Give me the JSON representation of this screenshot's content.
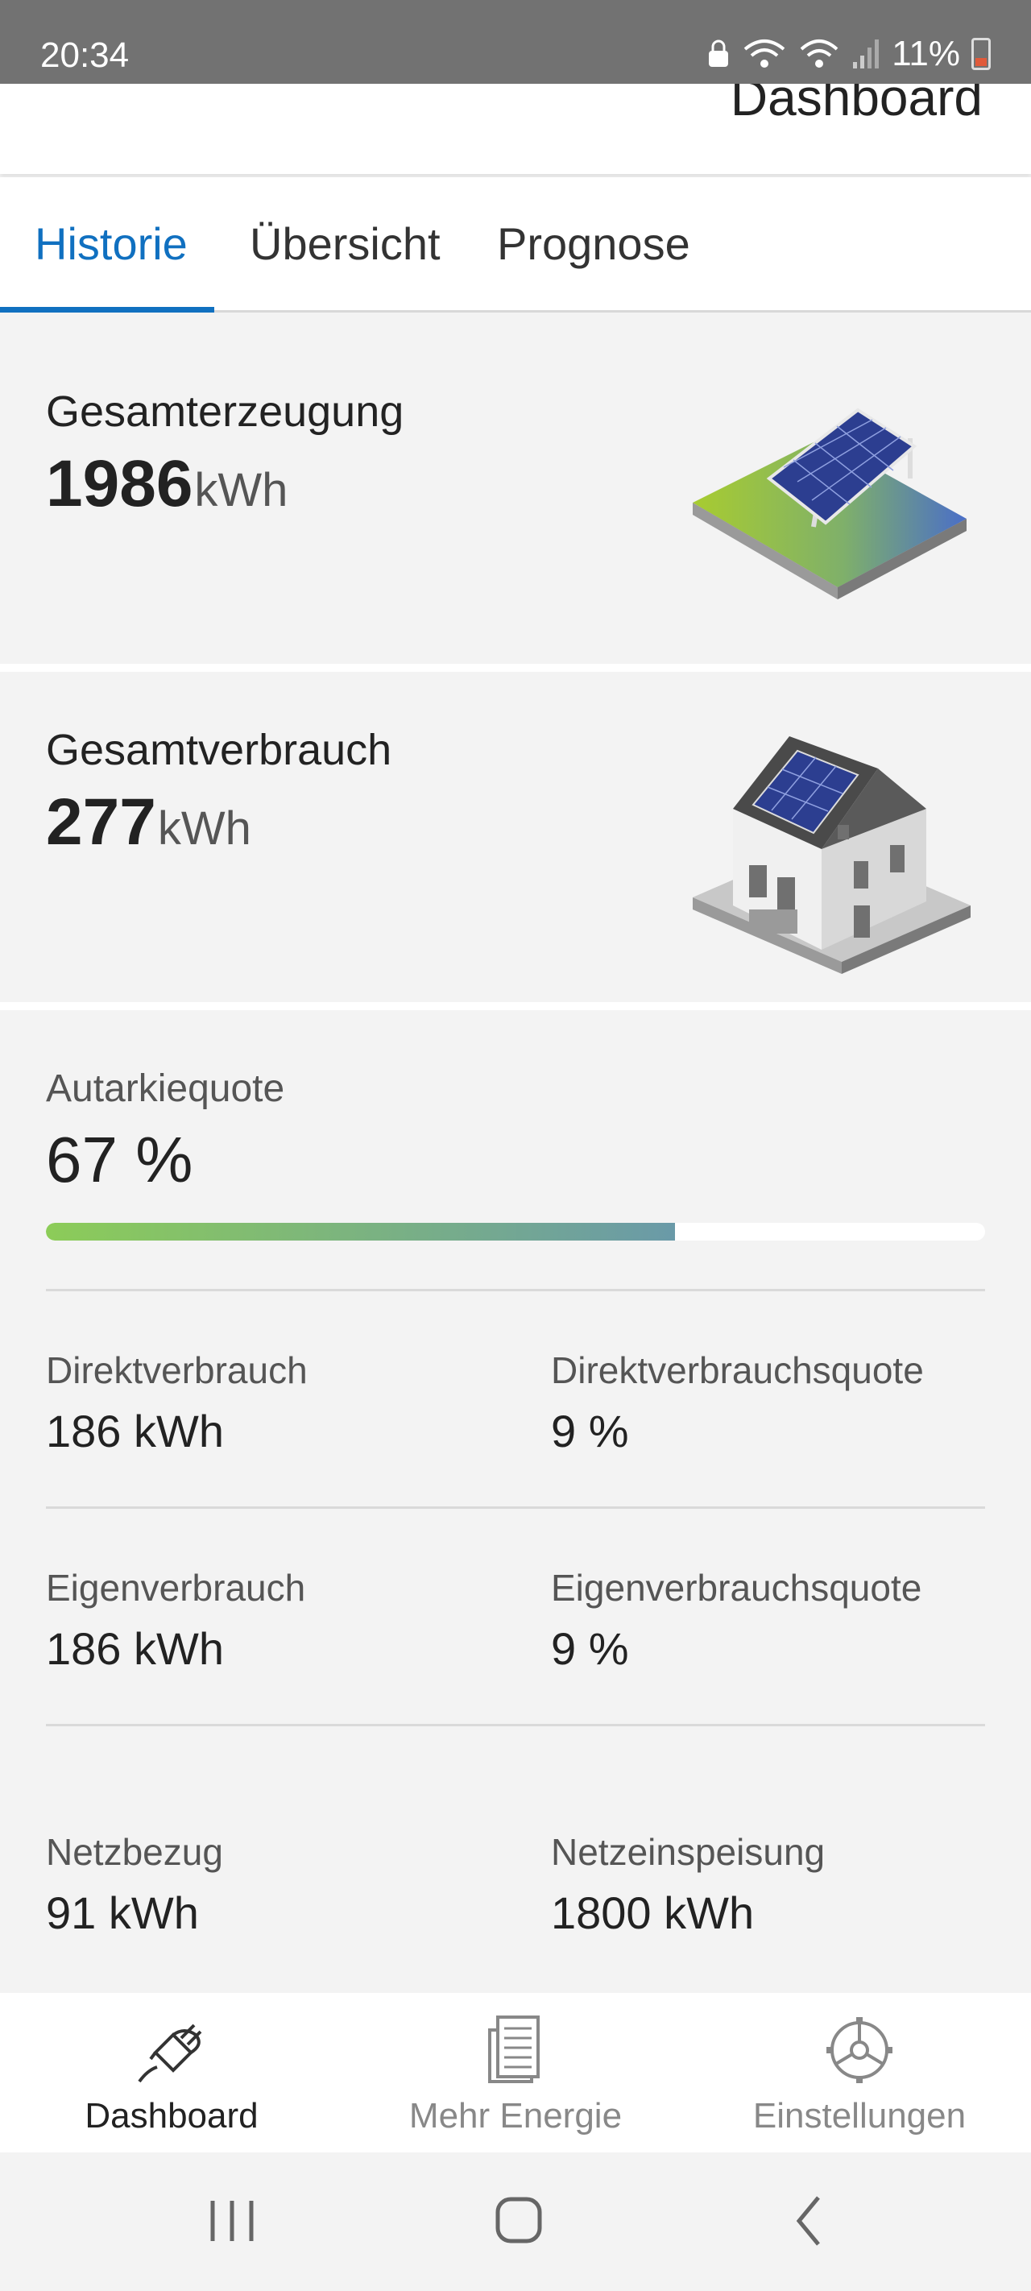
{
  "status_bar": {
    "time": "20:34",
    "battery": "11%"
  },
  "header": {
    "title": "Dashboard"
  },
  "tabs": [
    {
      "label": "Historie",
      "active": true
    },
    {
      "label": "Übersicht",
      "active": false
    },
    {
      "label": "Prognose",
      "active": false
    }
  ],
  "generation": {
    "label": "Gesamterzeugung",
    "value": "1986",
    "unit": "kWh"
  },
  "consumption": {
    "label": "Gesamtverbrauch",
    "value": "277",
    "unit": "kWh"
  },
  "autarky": {
    "label": "Autarkiequote",
    "value": "67 %",
    "fraction": 0.67
  },
  "stats": {
    "direct_consumption": {
      "label": "Direktverbrauch",
      "value": "186 kWh"
    },
    "direct_consumption_rate": {
      "label": "Direktverbrauchsquote",
      "value": "9 %"
    },
    "self_consumption": {
      "label": "Eigenverbrauch",
      "value": "186 kWh"
    },
    "self_consumption_rate": {
      "label": "Eigenverbrauchsquote",
      "value": "9 %"
    },
    "grid_import": {
      "label": "Netzbezug",
      "value": "91 kWh"
    },
    "grid_feed_in": {
      "label": "Netzeinspeisung",
      "value": "1800 kWh"
    }
  },
  "bottom_nav": [
    {
      "label": "Dashboard",
      "icon": "plug-icon",
      "active": true
    },
    {
      "label": "Mehr Energie",
      "icon": "newspaper-icon",
      "active": false
    },
    {
      "label": "Einstellungen",
      "icon": "gear-icon",
      "active": false
    }
  ],
  "colors": {
    "accent": "#1070c0",
    "bar_start": "#8ccc58",
    "bar_end": "#6a9aa8"
  }
}
